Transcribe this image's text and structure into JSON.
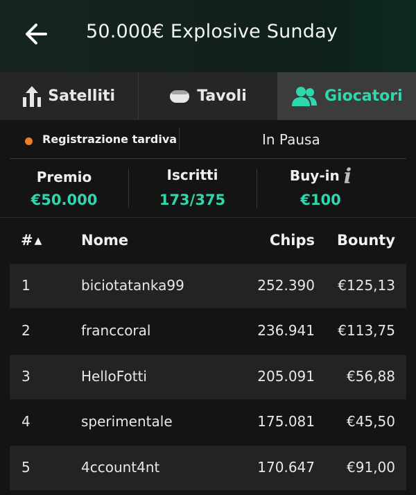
{
  "header": {
    "title": "50.000€ Explosive Sunday",
    "back_icon": "arrow-left-icon"
  },
  "tabs": [
    {
      "label": "Satelliti",
      "icon": "satellite-upload-icon",
      "active": false
    },
    {
      "label": "Tavoli",
      "icon": "table-icon",
      "active": false
    },
    {
      "label": "Giocatori",
      "icon": "users-icon",
      "active": true
    }
  ],
  "status": {
    "label": "Registrazione tardiva",
    "state": "In Pausa",
    "dot_color": "#ee7f27"
  },
  "stats": {
    "prize_label": "Premio",
    "prize_value": "€50.000",
    "entries_label": "Iscritti",
    "entries_value": "173/375",
    "buyin_label": "Buy-in",
    "buyin_value": "€100",
    "info_icon": "i"
  },
  "table": {
    "headers": {
      "rank": "#",
      "sort": "▲",
      "name": "Nome",
      "chips": "Chips",
      "bounty": "Bounty"
    },
    "rows": [
      {
        "rank": "1",
        "name": "biciotatanka99",
        "chips": "252.390",
        "bounty": "€125,13"
      },
      {
        "rank": "2",
        "name": "franccoral",
        "chips": "236.941",
        "bounty": "€113,75"
      },
      {
        "rank": "3",
        "name": "HelloFotti",
        "chips": "205.091",
        "bounty": "€56,88"
      },
      {
        "rank": "4",
        "name": "sperimentale",
        "chips": "175.081",
        "bounty": "€45,50"
      },
      {
        "rank": "5",
        "name": "4ccount4nt",
        "chips": "170.647",
        "bounty": "€91,00"
      }
    ]
  },
  "colors": {
    "accent": "#2fd8ac",
    "background": "#141414",
    "row_alt": "#232323"
  }
}
